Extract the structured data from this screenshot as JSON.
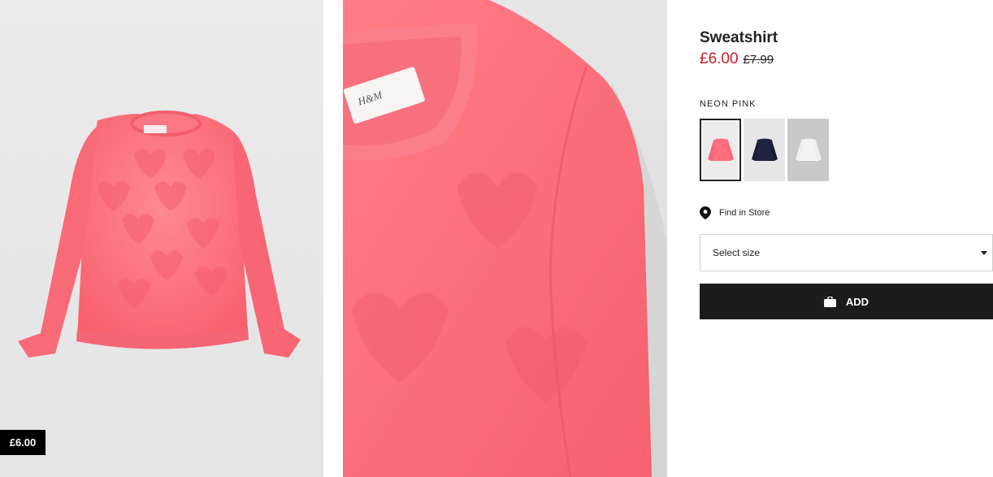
{
  "gallery": {
    "left_image_alt": "pink sweatshirt front",
    "mid_image_alt": "pink sweatshirt detail",
    "price_badge": "£6.00"
  },
  "product": {
    "title": "Sweatshirt",
    "price_sale": "£6.00",
    "price_original": "£7.99",
    "color_name": "NEON PINK",
    "swatches": [
      {
        "color": "#ff6f7e",
        "selected": true
      },
      {
        "color": "#1f2340",
        "selected": false
      },
      {
        "color": "#f4f4f4",
        "selected": false
      }
    ],
    "find_store_label": "Find in Store",
    "size_placeholder": "Select size",
    "add_label": "ADD"
  },
  "colors": {
    "sale": "#c41f2b",
    "button_bg": "#1c1c1c"
  }
}
